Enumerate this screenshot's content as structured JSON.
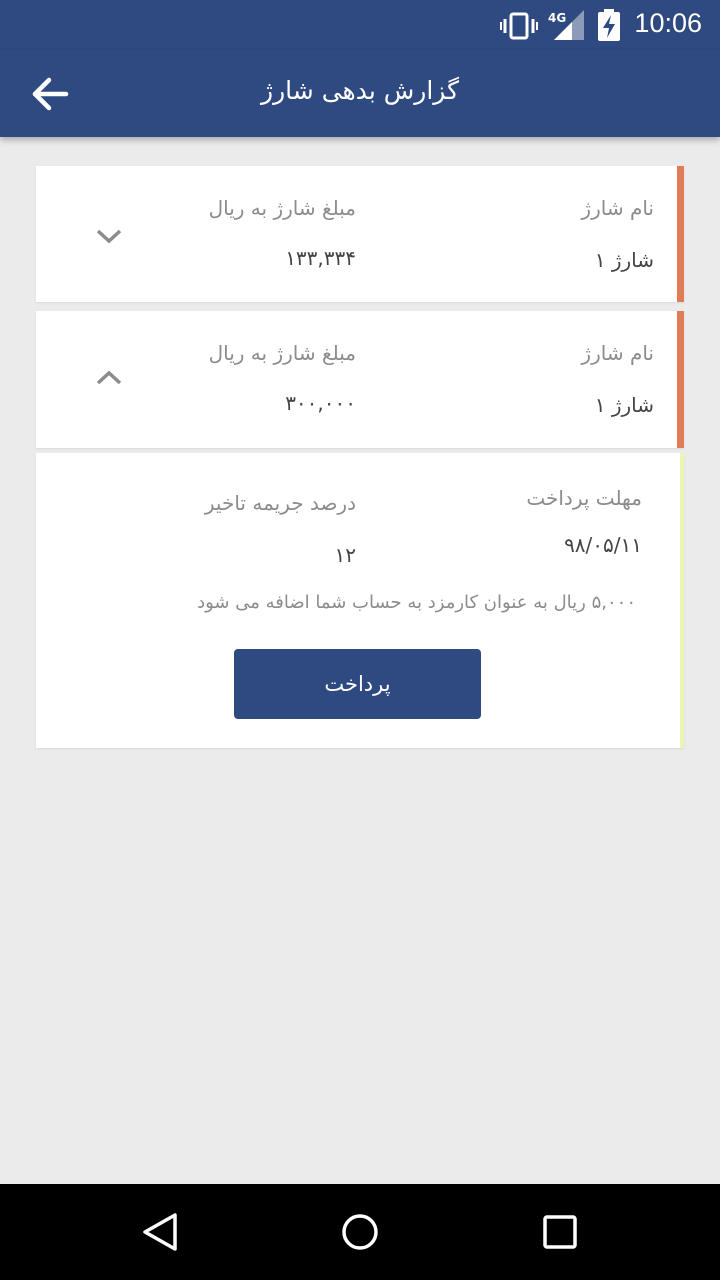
{
  "status_bar": {
    "time": "10:06",
    "network": "4G",
    "icons": [
      "vibrate-icon",
      "signal-icon",
      "battery-charging-icon"
    ]
  },
  "app_bar": {
    "title": "گزارش بدهی شارژ",
    "back_icon": "arrow-left-icon"
  },
  "charges": [
    {
      "name_label": "نام شارژ",
      "name_value": "شارژ ۱",
      "amount_label": "مبلغ شارژ به ریال",
      "amount_value": "۱۳۳,۳۳۴",
      "expanded": false,
      "stripe_color": "#e07c57"
    },
    {
      "name_label": "نام شارژ",
      "name_value": "شارژ ۱",
      "amount_label": "مبلغ شارژ به ریال",
      "amount_value": "۳۰۰,۰۰۰",
      "expanded": true,
      "stripe_color": "#e07c57"
    }
  ],
  "detail": {
    "deadline_label": "مهلت پرداخت",
    "deadline_value": "۹۸/۰۵/۱۱",
    "penalty_label": "درصد جریمه تاخیر",
    "penalty_value": "۱۲",
    "fee_note": "۵,۰۰۰  ریال به عنوان کارمزد به حساب شما اضافه می شود",
    "pay_button": "پرداخت",
    "stripe_color": "#e9f7b0"
  },
  "colors": {
    "primary": "#2f4a80",
    "background": "#ebebeb",
    "accent_stripe": "#e07c57"
  },
  "nav_bar": {
    "icons": [
      "back-triangle-icon",
      "home-circle-icon",
      "recents-square-icon"
    ]
  }
}
